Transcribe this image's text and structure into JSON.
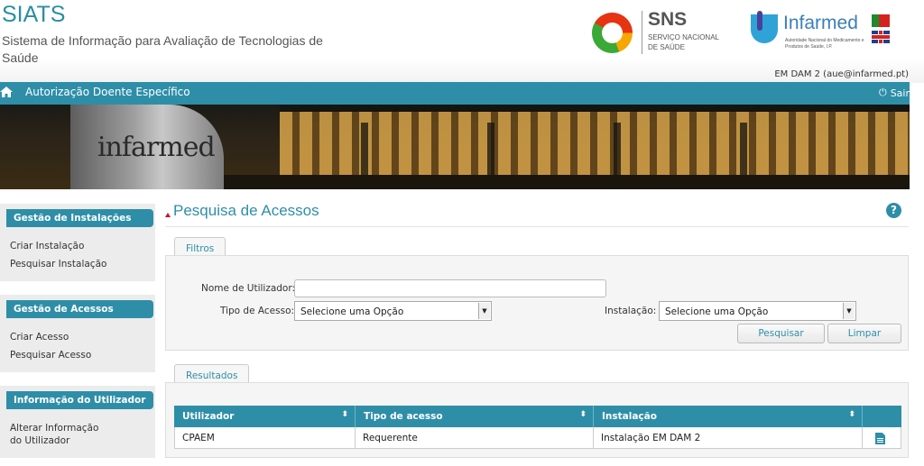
{
  "header": {
    "app_title": "SIATS",
    "app_subtitle": "Sistema de Informação para Avaliação de Tecnologias de Saúde",
    "sns_logo": {
      "name": "SNS",
      "subtitle": "SERVIÇO NACIONAL DE SAÚDE"
    },
    "infarmed_logo": {
      "name": "Infarmed",
      "subtitle": "Autoridade Nacional do Medicamento e Produtos de Saúde, I.P."
    },
    "user_info": "EM DAM 2 (aue@infarmed.pt)"
  },
  "navbar": {
    "title": "Autorização Doente Específico",
    "logout_label": "Sair",
    "home_icon": "home-icon",
    "logout_icon": "power-icon"
  },
  "banner": {
    "wall_text": "infarmed"
  },
  "sidebar": {
    "sections": [
      {
        "title": "Gestão de Instalações",
        "links": [
          "Criar Instalação",
          "Pesquisar Instalação"
        ]
      },
      {
        "title": "Gestão de Acessos",
        "links": [
          "Criar Acesso",
          "Pesquisar Acesso"
        ]
      },
      {
        "title": "Informação do Utilizador",
        "links": [
          "Alterar Informação do Utilizador"
        ]
      }
    ]
  },
  "main": {
    "page_title": "Pesquisa de Acessos",
    "help_icon": "?",
    "filters": {
      "tab_label": "Filtros",
      "username_label": "Nome de Utilizador:",
      "username_value": "",
      "access_type_label": "Tipo de Acesso:",
      "access_type_selected": "Selecione uma Opção",
      "installation_label": "Instalação:",
      "installation_selected": "Selecione uma Opção",
      "search_button": "Pesquisar",
      "clear_button": "Limpar"
    },
    "results": {
      "tab_label": "Resultados",
      "columns": [
        "Utilizador",
        "Tipo de acesso",
        "Instalação"
      ],
      "rows": [
        {
          "utilizador": "CPAEM",
          "tipo": "Requerente",
          "instalacao": "Instalação EM DAM 2"
        }
      ]
    }
  },
  "colors": {
    "accent": "#2e8ea8",
    "title": "#2a8ea3"
  }
}
